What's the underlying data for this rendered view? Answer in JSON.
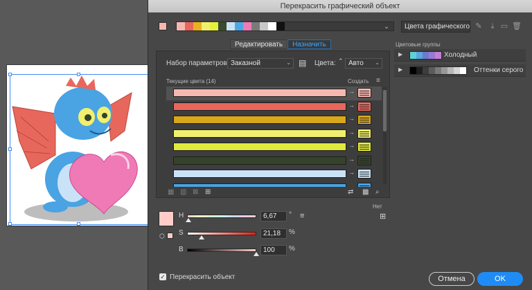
{
  "title": "Перекрасить графический объект",
  "colorgroup_name": "Цвета графического о",
  "group_swatches": [
    "#f7b7b1",
    "#e8675c",
    "#e9b11f",
    "#f2ef6e",
    "#e6f03c",
    "#3a4a2c",
    "#c9e2f5",
    "#4ea7e5",
    "#f07ab5",
    "#7a7a7a",
    "#c8c8c8",
    "#ffffff",
    "#111111"
  ],
  "tabs": [
    "Редактировать",
    "Назначить"
  ],
  "preset_label": "Набор параметров:",
  "preset_value": "Заказной",
  "colors_label": "Цвета:",
  "colors_value": "Авто",
  "current_colors_label": "Текущие цвета (14)",
  "create_label": "Создать",
  "color_rows": [
    {
      "color": "#f7b7b1",
      "new": "#f7b7b1"
    },
    {
      "color": "#e8675c",
      "new": "#e8675c"
    },
    {
      "color": "#d8a71a",
      "new": "#d8a71a"
    },
    {
      "color": "#f2ef6e",
      "new": "#f2ef6e"
    },
    {
      "color": "#e1ea3a",
      "new": "#e1ea3a"
    },
    {
      "color": "#34432a",
      "new": "#34432a"
    },
    {
      "color": "#c9e2f8",
      "new": "#c9e2f8"
    },
    {
      "color": "#4aa3e2",
      "new": "#4aa3e2"
    }
  ],
  "hsb": {
    "h_label": "H",
    "h_value": "6,67",
    "h_unit": "°",
    "s_label": "S",
    "s_value": "21,18",
    "s_unit": "%",
    "b_label": "B",
    "b_value": "100",
    "b_unit": "%",
    "h_level": 0.02,
    "s_level": 0.21,
    "b_level": 1.0,
    "swatch_color": "#ffccc8"
  },
  "none_label": "Нет",
  "color_groups_label": "Цветовые группы",
  "groups": [
    {
      "name": "Холодный",
      "colors": [
        "#5fd0d8",
        "#58a7e0",
        "#6d7ad0",
        "#9a78d6",
        "#c77fd6"
      ]
    },
    {
      "name": "Оттенки серого",
      "colors": [
        "#000000",
        "#1f1f1f",
        "#3d3d3d",
        "#5c5c5c",
        "#7a7a7a",
        "#999999",
        "#b8b8b8",
        "#d6d6d6",
        "#ffffff"
      ]
    }
  ],
  "recolor_label": "Перекрасить объект",
  "cancel_label": "Отмена",
  "ok_label": "OK"
}
